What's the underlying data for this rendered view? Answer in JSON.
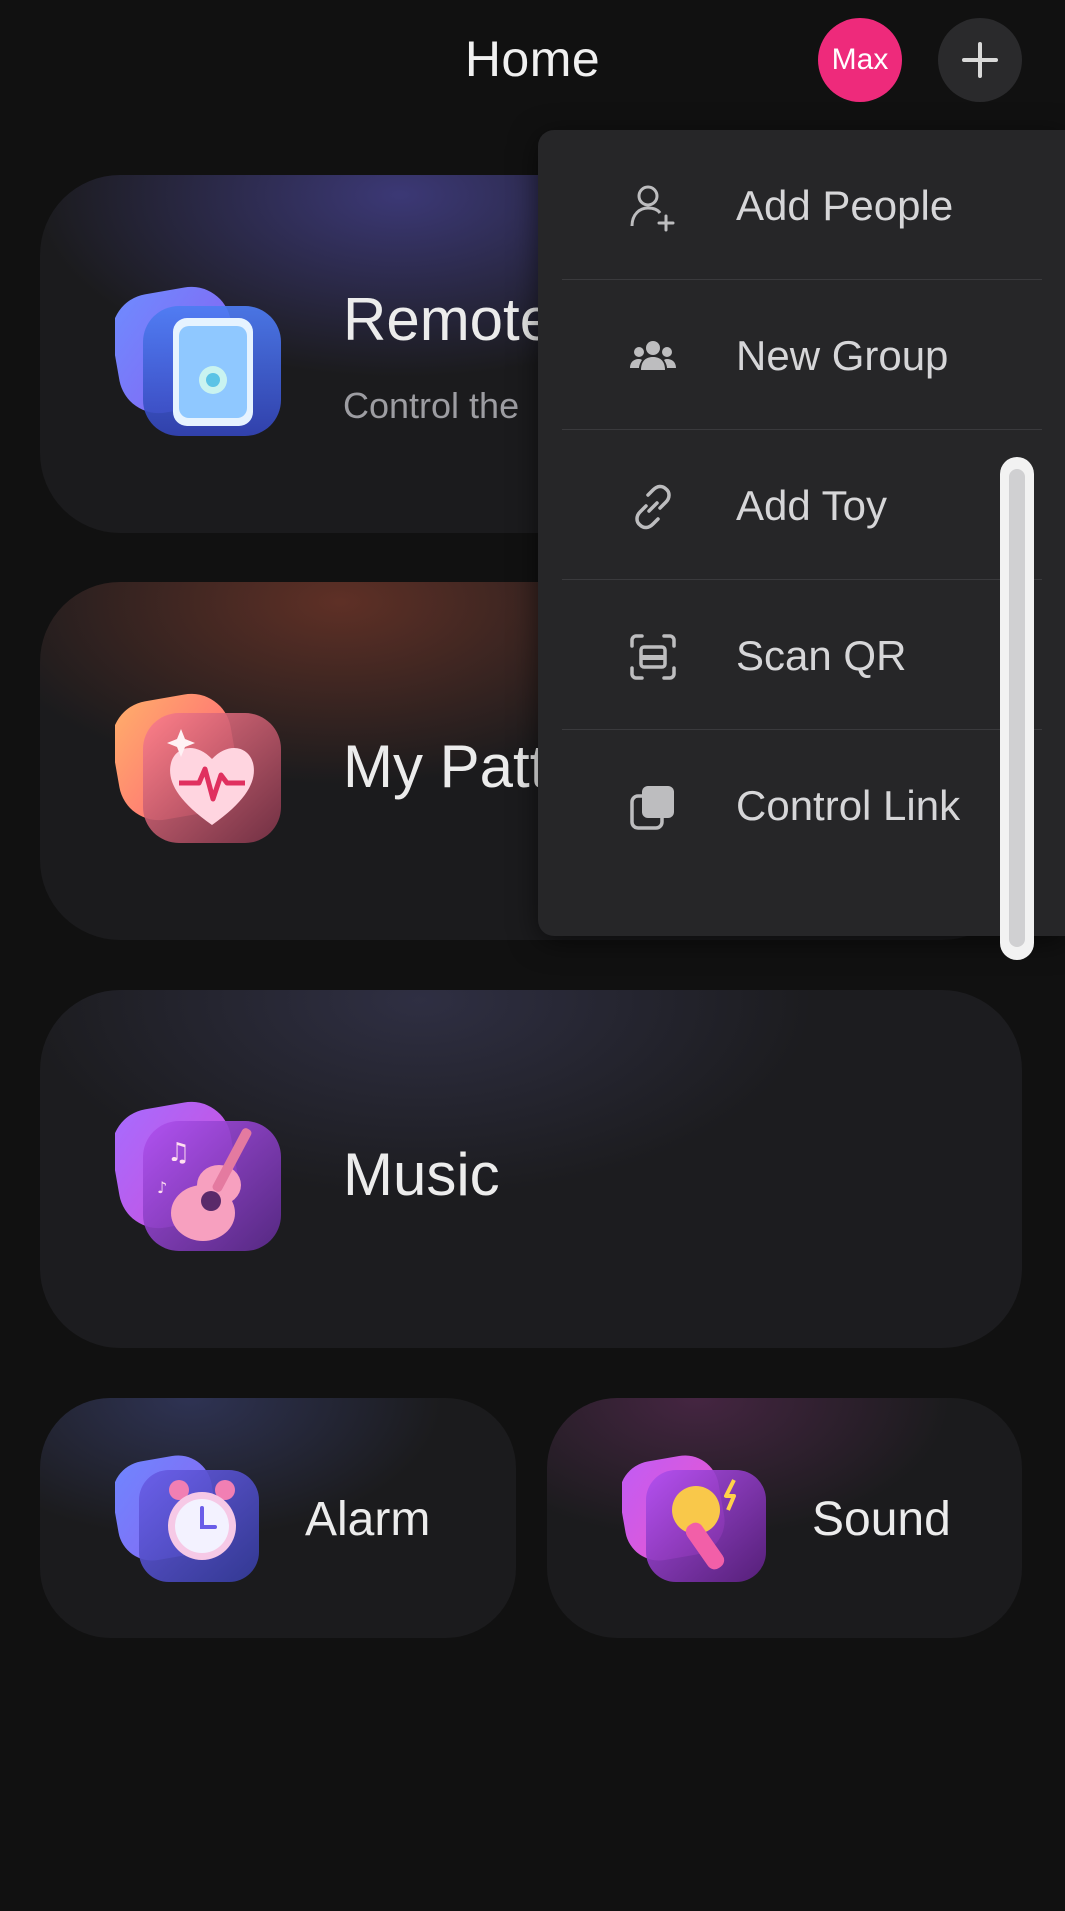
{
  "header": {
    "title": "Home",
    "avatar_label": "Max",
    "add_icon": "plus-icon"
  },
  "cards": {
    "remote": {
      "title": "Remote",
      "subtitle": "Control the",
      "icon": "phone-icon"
    },
    "pattern": {
      "title": "My Patt",
      "icon": "heart-pulse-icon"
    },
    "music": {
      "title": "Music",
      "icon": "guitar-icon"
    },
    "alarm": {
      "title": "Alarm",
      "icon": "alarm-clock-icon"
    },
    "sound": {
      "title": "Sound",
      "icon": "microphone-icon"
    }
  },
  "menu": {
    "items": [
      {
        "label": "Add People",
        "icon": "add-person-icon"
      },
      {
        "label": "New Group",
        "icon": "group-icon"
      },
      {
        "label": "Add Toy",
        "icon": "link-icon"
      },
      {
        "label": "Scan QR",
        "icon": "scan-qr-icon"
      },
      {
        "label": "Control Link",
        "icon": "copy-link-icon"
      }
    ]
  },
  "colors": {
    "background": "#111111",
    "avatar": "#ee2a7b",
    "menu": "#262628",
    "card": "#1b1b1d"
  }
}
